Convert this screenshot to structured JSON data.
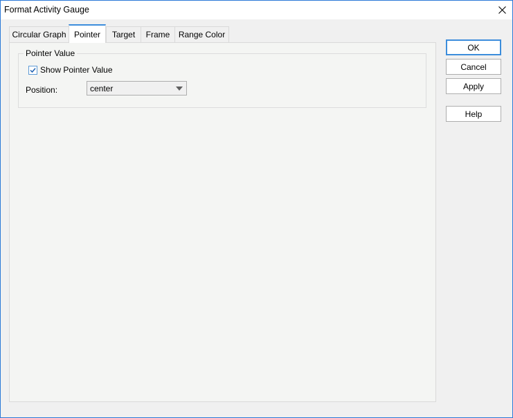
{
  "window": {
    "title": "Format Activity Gauge",
    "close_icon": "close-icon"
  },
  "tabs": [
    {
      "label": "Circular Graph",
      "active": false
    },
    {
      "label": "Pointer",
      "active": true
    },
    {
      "label": "Target",
      "active": false
    },
    {
      "label": "Frame",
      "active": false
    },
    {
      "label": "Range Color",
      "active": false
    }
  ],
  "pointer_value": {
    "group_title": "Pointer Value",
    "show_pointer_value": {
      "label": "Show Pointer Value",
      "checked": true
    },
    "position": {
      "label": "Position:",
      "value": "center"
    }
  },
  "buttons": {
    "ok": "OK",
    "cancel": "Cancel",
    "apply": "Apply",
    "help": "Help"
  },
  "colors": {
    "accent": "#3c8ddc",
    "window_border": "#2b79d7"
  }
}
